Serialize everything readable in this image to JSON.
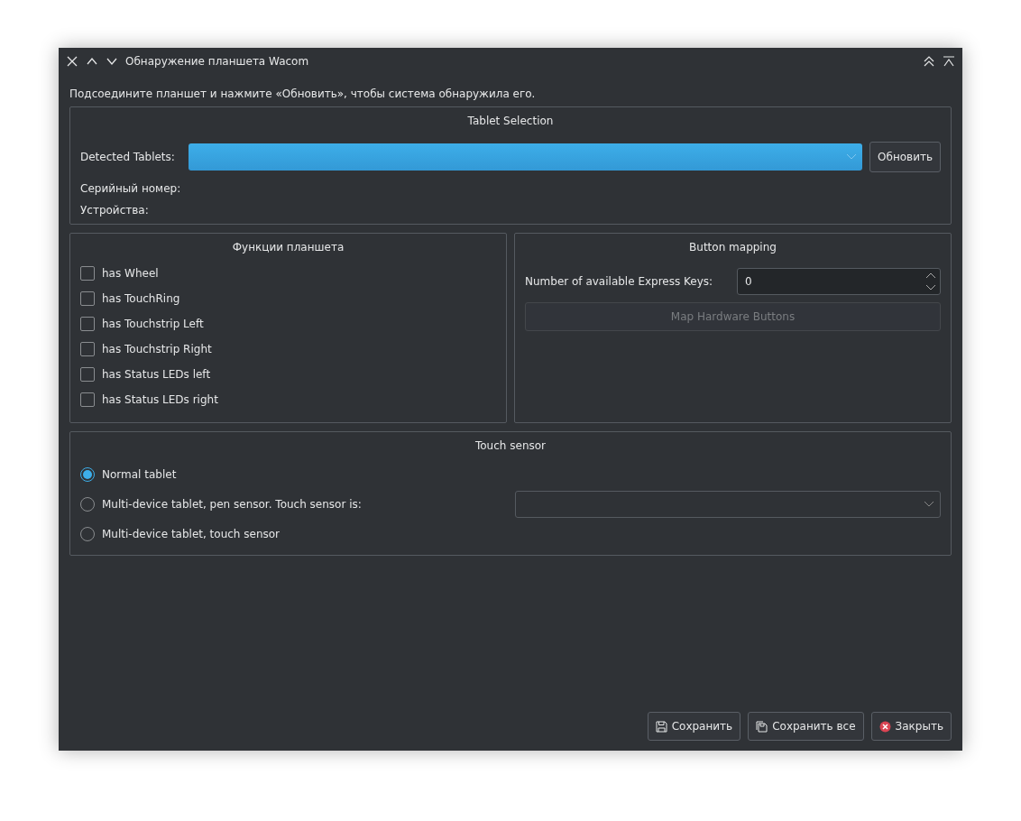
{
  "window": {
    "title": "Обнаружение планшета Wacom"
  },
  "message": "Подсоедините планшет и нажмите «Обновить», чтобы система обнаружила его.",
  "tablet_selection": {
    "title": "Tablet Selection",
    "detected_label": "Detected Tablets:",
    "refresh_button": "Обновить",
    "serial_label": "Серийный номер:",
    "devices_label": "Устройства:"
  },
  "features": {
    "title": "Функции планшета",
    "items": [
      {
        "label": "has Wheel",
        "checked": false
      },
      {
        "label": "has TouchRing",
        "checked": false
      },
      {
        "label": "has Touchstrip Left",
        "checked": false
      },
      {
        "label": "has Touchstrip Right",
        "checked": false
      },
      {
        "label": "has Status LEDs left",
        "checked": false
      },
      {
        "label": "has Status LEDs right",
        "checked": false
      }
    ]
  },
  "button_mapping": {
    "title": "Button mapping",
    "keys_label": "Number of available Express Keys:",
    "keys_value": "0",
    "map_button": {
      "label": "Map Hardware Buttons",
      "disabled": true
    }
  },
  "touch_sensor": {
    "title": "Touch sensor",
    "options": [
      {
        "label": "Normal tablet",
        "selected": true
      },
      {
        "label": "Multi-device tablet, pen sensor. Touch sensor is:",
        "selected": false
      },
      {
        "label": "Multi-device tablet, touch sensor",
        "selected": false
      }
    ]
  },
  "buttons": [
    {
      "label": "Сохранить",
      "kind": "save"
    },
    {
      "label": "Сохранить все",
      "kind": "save-all"
    },
    {
      "label": "Закрыть",
      "kind": "close"
    }
  ]
}
